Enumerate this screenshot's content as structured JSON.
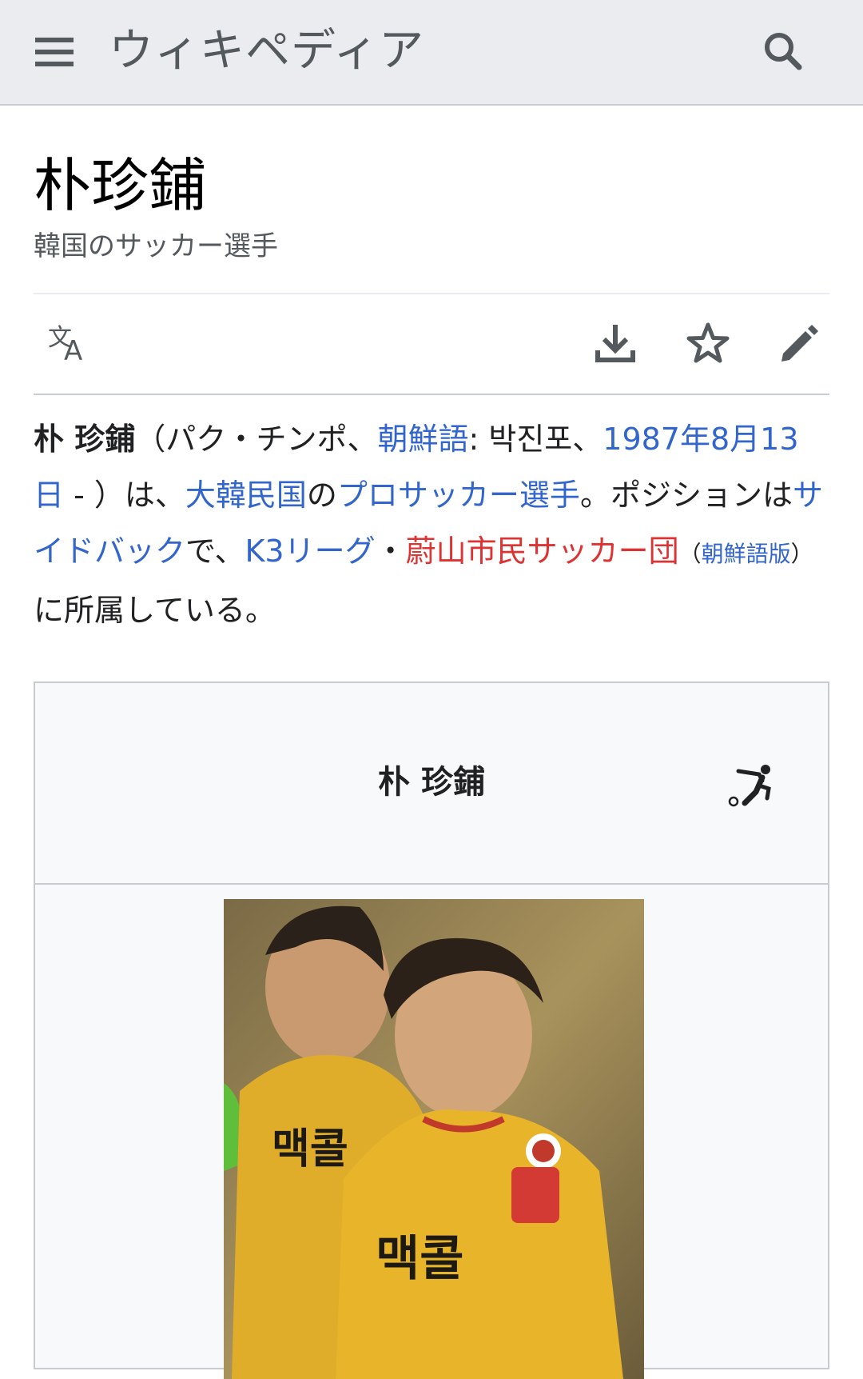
{
  "header": {
    "wordmark": "ウィキペディア",
    "menu_icon": "hamburger-menu-icon",
    "search_icon": "search-icon"
  },
  "page": {
    "title": "朴珍鋪",
    "description": "韓国のサッカー選手"
  },
  "toolbar": {
    "language_icon": "language-icon",
    "download_icon": "download-icon",
    "watch_icon": "star-icon",
    "edit_icon": "pencil-icon"
  },
  "lead": {
    "name_bold": "朴 珍鋪",
    "part1": "（パク・チンポ、",
    "link_korean": "朝鮮語",
    "part2": ": 박진포、",
    "link_birthdate": "1987年8月13日",
    "part3": " - ）は、",
    "link_country": "大韓民国",
    "part4": "の",
    "link_pro": "プロサッカー選手",
    "part5": "。ポジションは",
    "link_position": "サイドバック",
    "part6": "で、",
    "link_league": "K3リーグ",
    "part7": "・",
    "link_club": "蔚山市民サッカー団",
    "part8_open": "（",
    "link_korean_edition": "朝鮮語版",
    "part8_close": "）",
    "part9": "に所属している。"
  },
  "infobox": {
    "name": "朴 珍鋪",
    "sport_icon": "football-player-icon",
    "photo_alt": "player photo"
  },
  "colors": {
    "link": "#3366cc",
    "redlink": "#d33",
    "header_bg": "#eaecf0",
    "infobox_bg": "#f8f9fa",
    "kit_yellow": "#e8b42a"
  }
}
